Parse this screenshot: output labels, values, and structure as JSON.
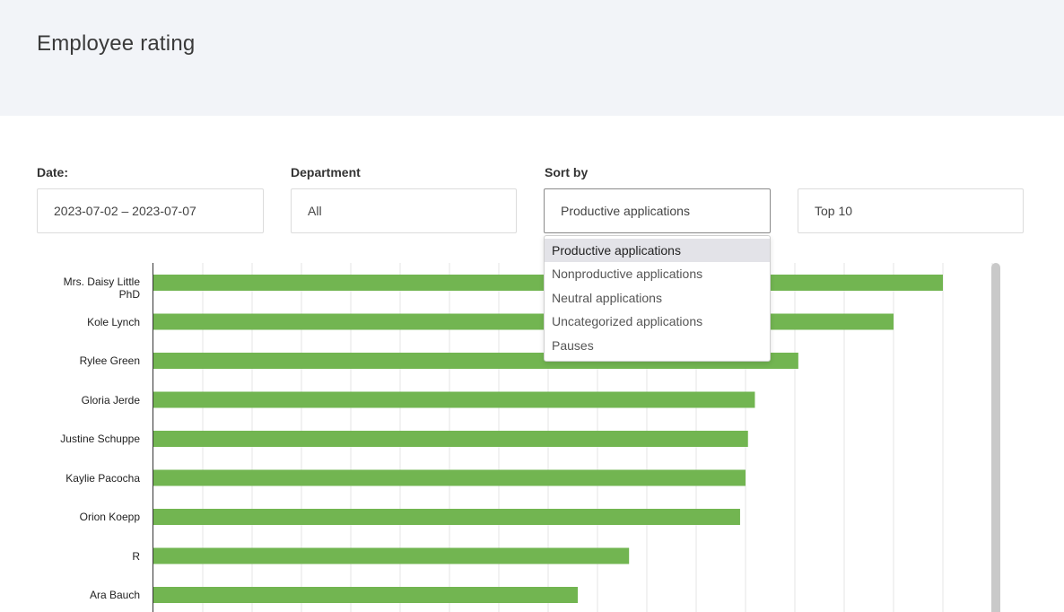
{
  "header": {
    "title": "Employee rating"
  },
  "filters": {
    "date": {
      "label": "Date:",
      "value": "2023-07-02 – 2023-07-07"
    },
    "department": {
      "label": "Department",
      "value": "All"
    },
    "sort": {
      "label": "Sort by",
      "value": "Productive applications"
    },
    "limit": {
      "value": "Top 10"
    }
  },
  "sort_options": [
    "Productive applications",
    "Nonproductive applications",
    "Neutral applications",
    "Uncategorized applications",
    "Pauses"
  ],
  "colors": {
    "bar": "#72b551",
    "header_bg": "#f2f4f8",
    "gridline": "#e6e6e6",
    "axis": "#333333"
  },
  "chart_data": {
    "type": "bar",
    "orientation": "horizontal",
    "categories": [
      "Mrs. Daisy Little PhD",
      "Kole Lynch",
      "Rylee Green",
      "Gloria Jerde",
      "Justine Schuppe",
      "Kaylie Pacocha",
      "Orion Koepp",
      "R",
      "Ara Bauch"
    ],
    "category_lines": [
      [
        "Mrs. Daisy Little",
        "PhD"
      ],
      [
        "Kole Lynch"
      ],
      [
        "Rylee Green"
      ],
      [
        "Gloria Jerde"
      ],
      [
        "Justine Schuppe"
      ],
      [
        "Kaylie Pacocha"
      ],
      [
        "Orion Koepp"
      ],
      [
        "R"
      ],
      [
        "Ara Bauch"
      ]
    ],
    "values": [
      160,
      150,
      130.7,
      121.9,
      120.5,
      120,
      118.9,
      96.4,
      86
    ],
    "xlim": [
      0,
      170
    ],
    "grid": true,
    "grid_step": 10,
    "legend": "none"
  }
}
